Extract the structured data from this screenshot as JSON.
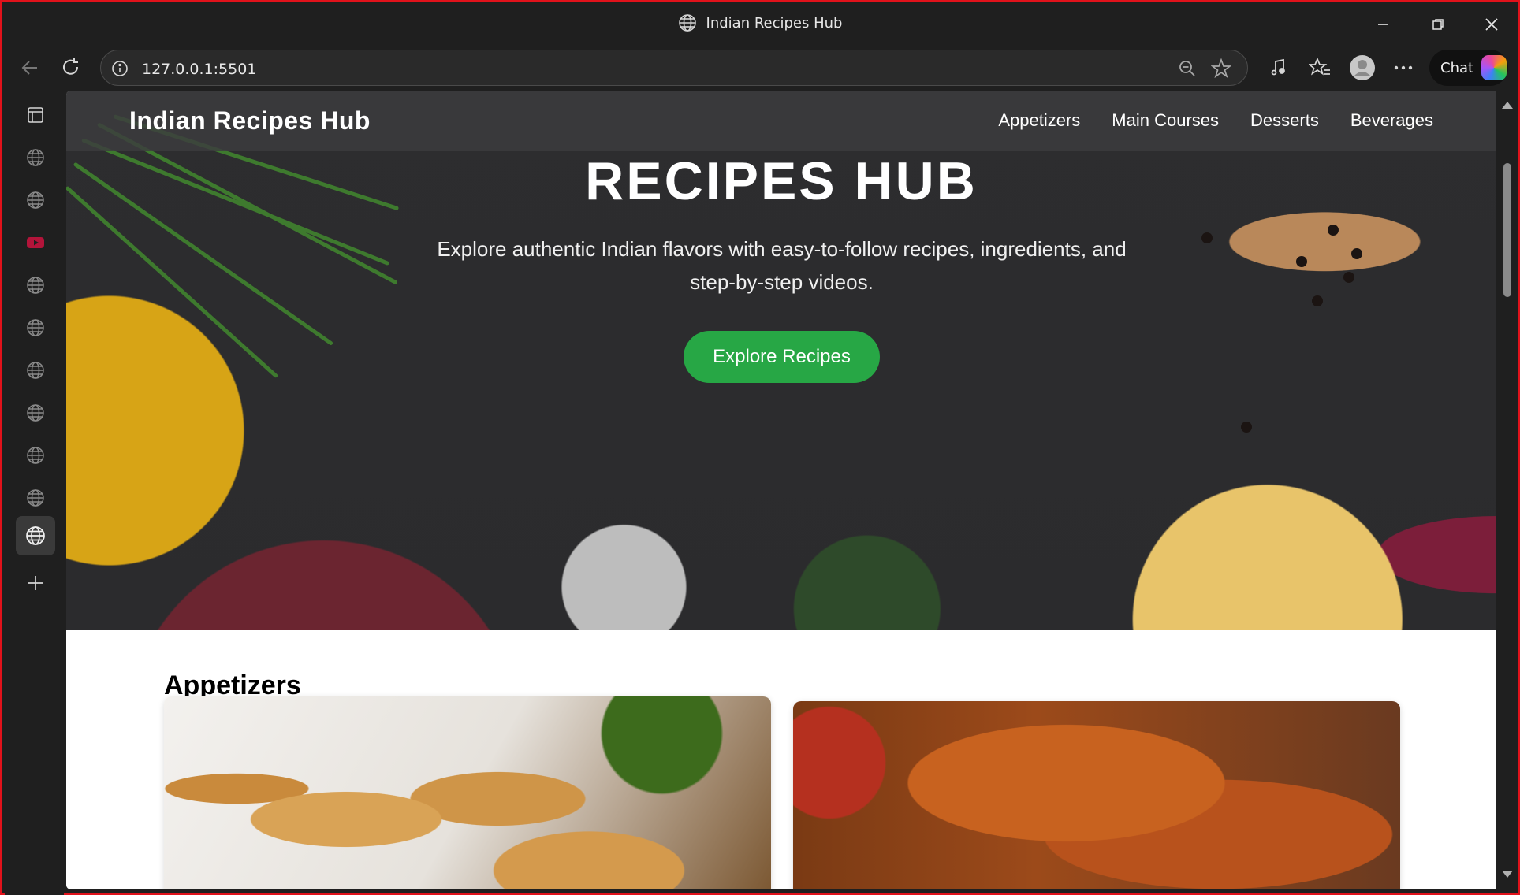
{
  "browser": {
    "window_title": "Indian Recipes Hub",
    "url": "127.0.0.1:5501",
    "chat_label": "Chat"
  },
  "sidebar": {
    "tabs": [
      "tab-globe",
      "tab-globe",
      "tab-youtube",
      "tab-globe",
      "tab-globe",
      "tab-globe",
      "tab-globe",
      "tab-globe",
      "tab-globe",
      "tab-globe-active"
    ]
  },
  "page": {
    "navbar": {
      "logo": "Indian Recipes Hub",
      "links": [
        "Appetizers",
        "Main Courses",
        "Desserts",
        "Beverages"
      ]
    },
    "hero": {
      "title": "RECIPES HUB",
      "subtitle": "Explore authentic Indian flavors with easy-to-follow recipes, ingredients, and step-by-step videos.",
      "cta": "Explore Recipes"
    },
    "section": {
      "title": "Appetizers"
    }
  },
  "colors": {
    "accent_button": "#27a745",
    "frame_border": "#e0121b"
  }
}
